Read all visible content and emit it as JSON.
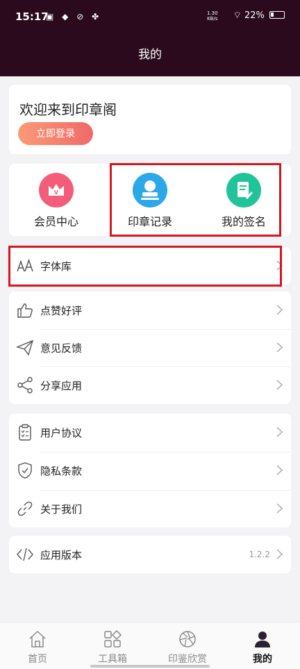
{
  "status_bar": {
    "time": "15:17",
    "net_speed_value": "1.30",
    "net_speed_unit": "KB/s",
    "battery": "22%"
  },
  "header": {
    "title": "我的"
  },
  "welcome": {
    "title": "欢迎来到印章阁",
    "login_label": "立即登录"
  },
  "quick_actions": [
    {
      "label": "会员中心",
      "icon": "vip-crown-icon",
      "color": "#f35d79"
    },
    {
      "label": "印章记录",
      "icon": "stamp-icon",
      "color": "#2aa8e8"
    },
    {
      "label": "我的签名",
      "icon": "signature-icon",
      "color": "#21c49a"
    }
  ],
  "font_library": {
    "label": "字体库",
    "icon": "font-icon"
  },
  "group_social": [
    {
      "label": "点赞好评",
      "icon": "thumbs-up-icon"
    },
    {
      "label": "意见反馈",
      "icon": "paper-plane-icon"
    },
    {
      "label": "分享应用",
      "icon": "share-icon"
    }
  ],
  "group_legal": [
    {
      "label": "用户协议",
      "icon": "clipboard-icon"
    },
    {
      "label": "隐私条款",
      "icon": "shield-check-icon"
    },
    {
      "label": "关于我们",
      "icon": "link-icon"
    }
  ],
  "version_row": {
    "label": "应用版本",
    "value": "1.2.2",
    "icon": "code-icon"
  },
  "tabs": [
    {
      "label": "首页",
      "icon": "home-icon",
      "active": false
    },
    {
      "label": "工具箱",
      "icon": "toolbox-icon",
      "active": false
    },
    {
      "label": "印鉴欣赏",
      "icon": "aperture-icon",
      "active": false
    },
    {
      "label": "我的",
      "icon": "person-icon",
      "active": true
    }
  ],
  "colors": {
    "header_bg": "#2a0a1c",
    "accent_gradient_start": "#fb9a76",
    "accent_gradient_end": "#ef6a68",
    "highlight_red": "#d9141e"
  }
}
